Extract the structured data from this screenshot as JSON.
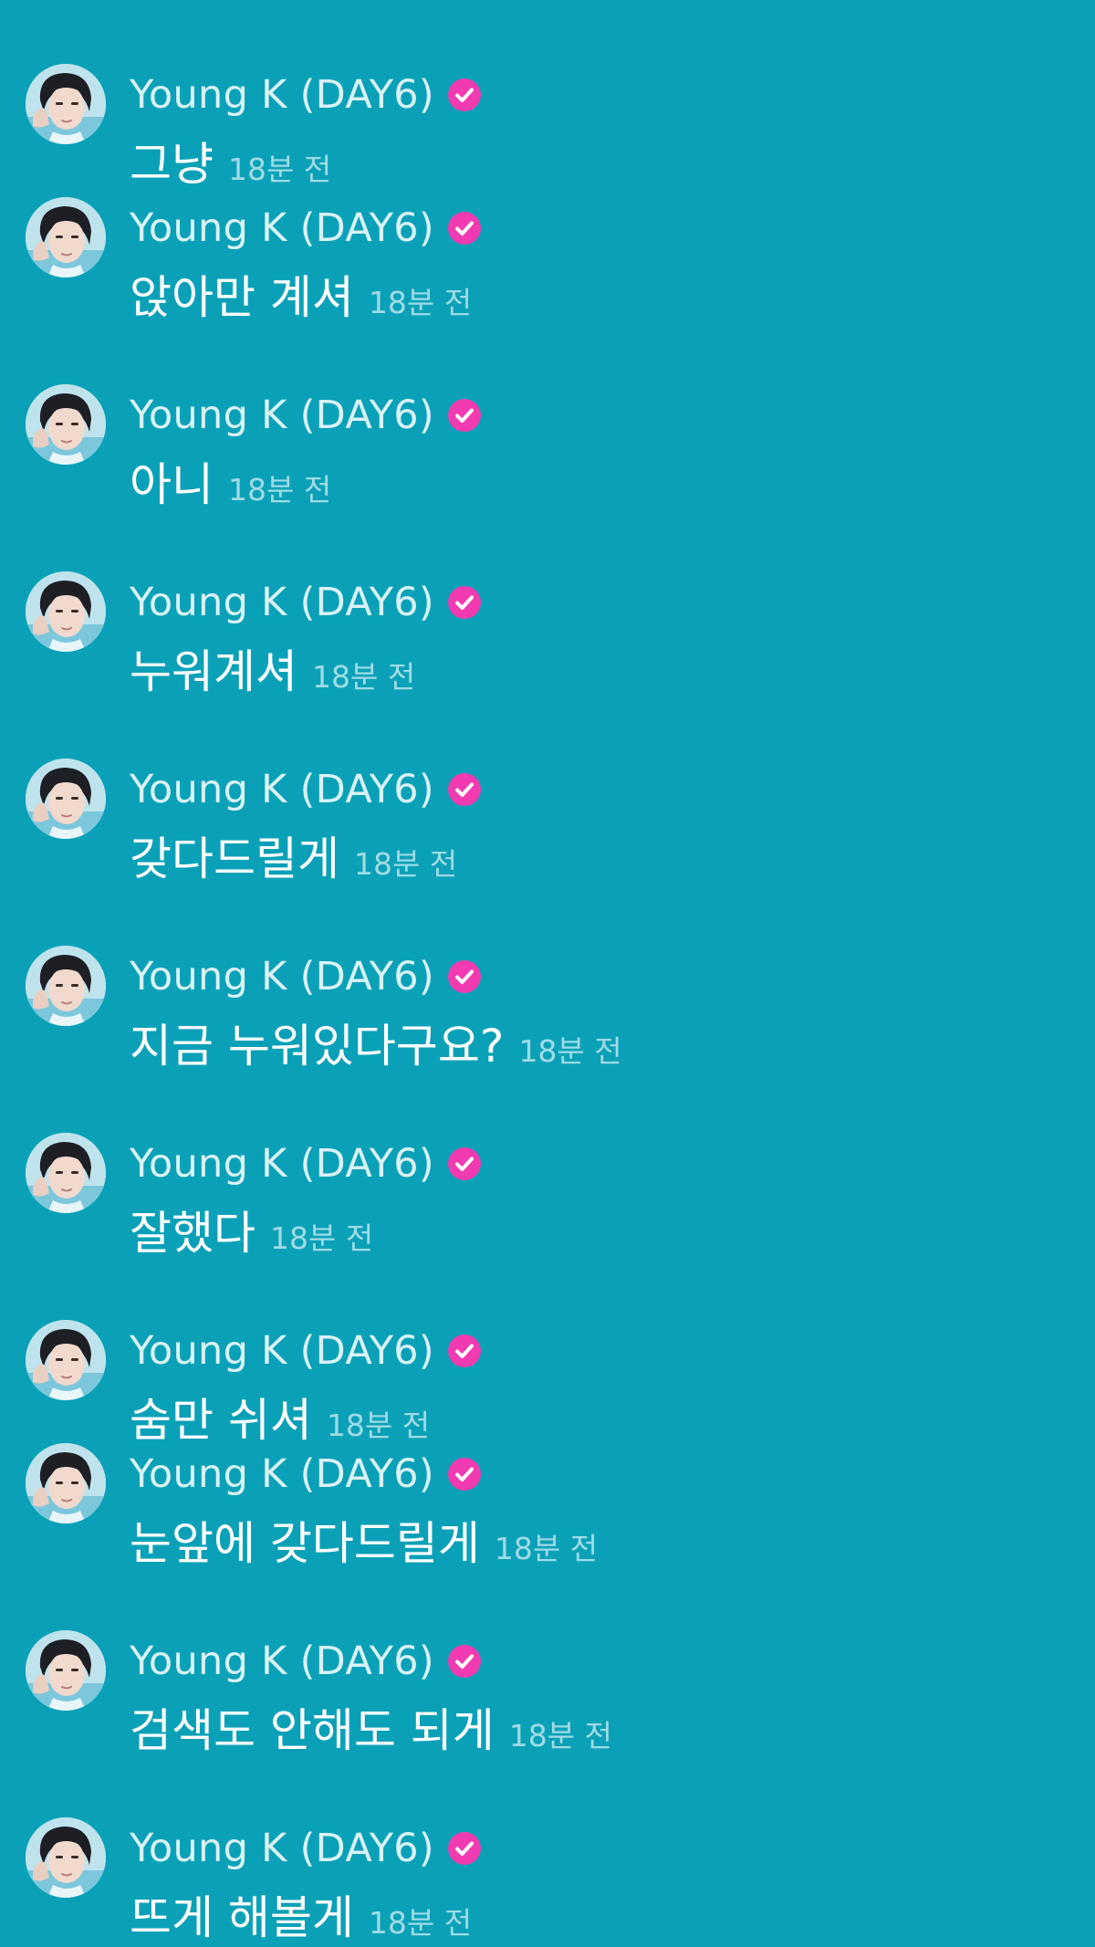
{
  "colors": {
    "background": "#0aa1b8",
    "name": "#d9f2f5",
    "message": "#ffffff",
    "timestamp": "#9fdbe5",
    "verified_badge": "#f23bb0"
  },
  "icons": {
    "avatar": "profile-photo",
    "badge": "verified-check-icon"
  },
  "messages": [
    {
      "author": "Young K (DAY6)",
      "text": "그냥",
      "time": "18분 전"
    },
    {
      "author": "Young K (DAY6)",
      "text": "앉아만 계셔",
      "time": "18분 전"
    },
    {
      "author": "Young K (DAY6)",
      "text": "아니",
      "time": "18분 전"
    },
    {
      "author": "Young K (DAY6)",
      "text": "누워계셔",
      "time": "18분 전"
    },
    {
      "author": "Young K (DAY6)",
      "text": "갖다드릴게",
      "time": "18분 전"
    },
    {
      "author": "Young K (DAY6)",
      "text": "지금 누워있다구요?",
      "time": "18분 전"
    },
    {
      "author": "Young K (DAY6)",
      "text": "잘했다",
      "time": "18분 전"
    },
    {
      "author": "Young K (DAY6)",
      "text": "숨만 쉬셔",
      "time": "18분 전"
    },
    {
      "author": "Young K (DAY6)",
      "text": "눈앞에 갖다드릴게",
      "time": "18분 전"
    },
    {
      "author": "Young K (DAY6)",
      "text": "검색도 안해도 되게",
      "time": "18분 전"
    },
    {
      "author": "Young K (DAY6)",
      "text": "뜨게 해볼게",
      "time": "18분 전"
    }
  ]
}
